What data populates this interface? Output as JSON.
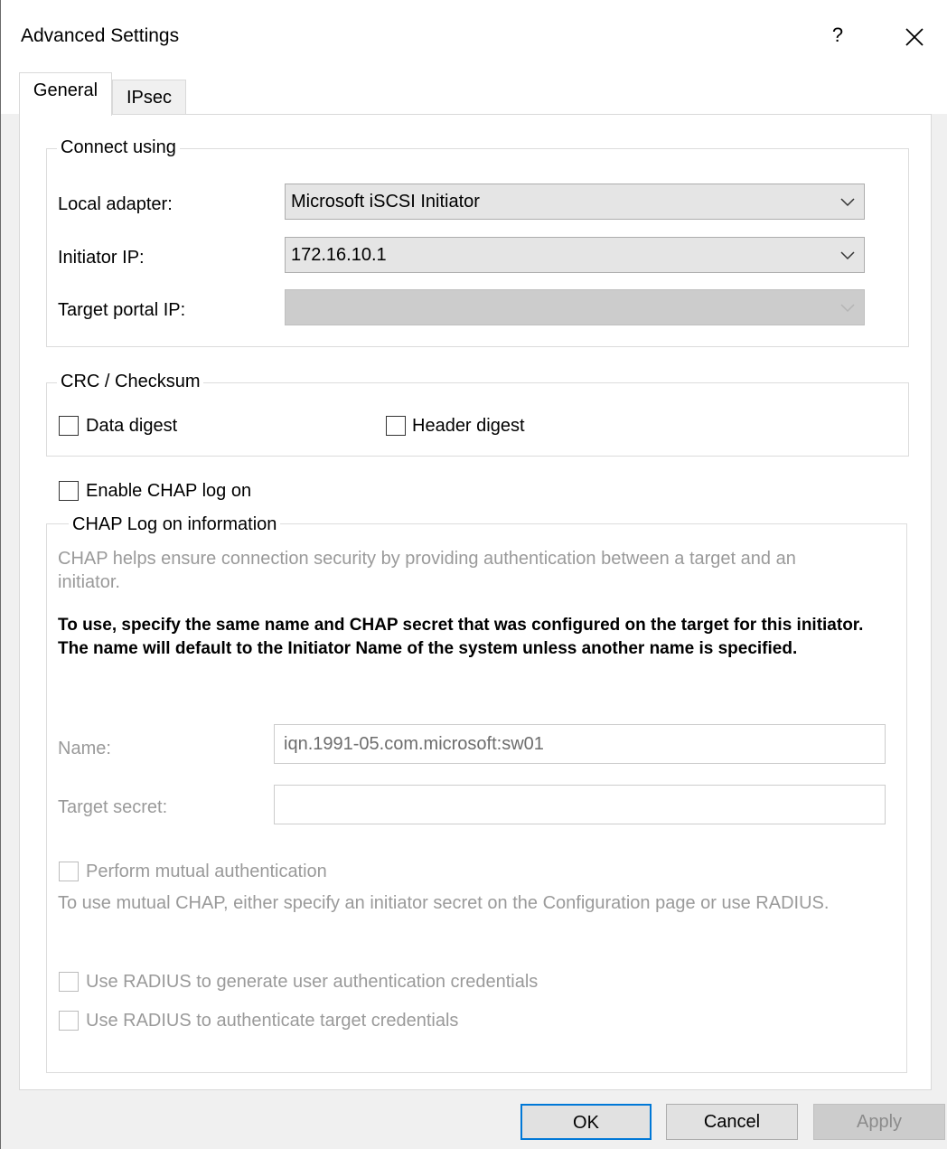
{
  "window": {
    "title": "Advanced Settings",
    "help": "?",
    "colors": {
      "accent": "#0078d7",
      "disabled_text": "#9a9a9a"
    }
  },
  "tabs": [
    {
      "label": "General",
      "active": true
    },
    {
      "label": "IPsec",
      "active": false
    }
  ],
  "connect_using": {
    "legend": "Connect using",
    "local_adapter_label": "Local adapter:",
    "local_adapter_value": "Microsoft iSCSI Initiator",
    "initiator_ip_label": "Initiator IP:",
    "initiator_ip_value": "172.16.10.1",
    "target_portal_ip_label": "Target portal IP:",
    "target_portal_ip_value": ""
  },
  "crc": {
    "legend": "CRC / Checksum",
    "data_digest": "Data digest",
    "header_digest": "Header digest"
  },
  "chap": {
    "enable_label": "Enable CHAP log on",
    "legend": "CHAP Log on information",
    "desc": "CHAP helps ensure connection security by providing authentication between a target and an initiator.",
    "instructions": "To use, specify the same name and CHAP secret that was configured on the target for this initiator.  The name will default to the Initiator Name of the system unless another name is specified.",
    "name_label": "Name:",
    "name_value": "iqn.1991-05.com.microsoft:sw01",
    "secret_label": "Target secret:",
    "secret_value": "",
    "mutual_label": "Perform mutual authentication",
    "mutual_desc": "To use mutual CHAP, either specify an initiator secret on the Configuration page or use RADIUS.",
    "radius_generate_label": "Use RADIUS to generate user authentication credentials",
    "radius_authenticate_label": "Use RADIUS to authenticate target credentials"
  },
  "buttons": {
    "ok": "OK",
    "cancel": "Cancel",
    "apply": "Apply"
  }
}
